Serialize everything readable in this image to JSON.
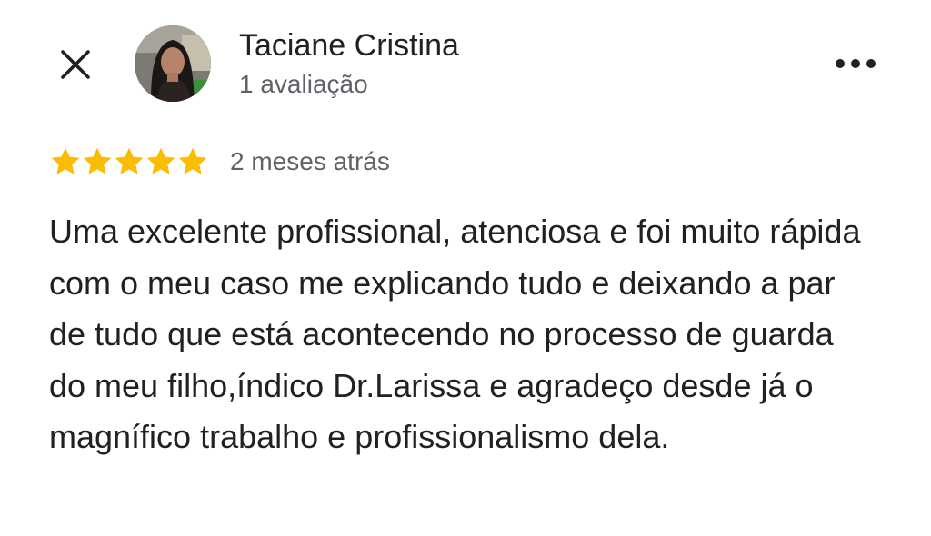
{
  "header": {
    "close_icon": "close-icon",
    "more_icon": "more-horizontal-icon",
    "author": {
      "name": "Taciane Cristina",
      "meta": "1 avaliação",
      "avatar": "profile-photo"
    }
  },
  "review": {
    "rating": 5,
    "rating_max": 5,
    "star_color": "#fbbc04",
    "date": "2 meses atrás",
    "text": "Uma excelente profissional, atenciosa e foi muito rápida com o meu caso me explicando tudo e deixando a par de tudo que está acontecendo no processo de guarda do meu filho,índico Dr.Larissa e agradeço desde já o magnífico trabalho e profissionalismo dela."
  }
}
